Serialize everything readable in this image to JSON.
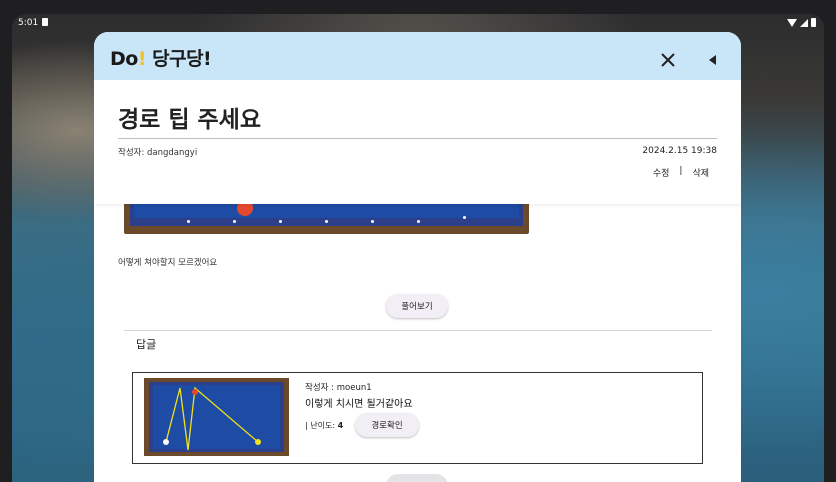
{
  "status_bar": {
    "time": "5:01"
  },
  "app": {
    "logo_prefix": "Do",
    "logo_bang": "!",
    "logo_suffix": " 당구당!"
  },
  "post": {
    "title": "경로 팁 주세요",
    "author": "작성자: dangdangyi",
    "date": "2024.2.15  19:38",
    "edit_label": "수정",
    "separator": "|",
    "delete_label": "삭제",
    "description": "어떻게 쳐야할지 모르겠어요",
    "solve_button": "풀어보기"
  },
  "replies": {
    "label": "답글",
    "items": [
      {
        "author": "작성자 : moeun1",
        "text": "이렇게 치시면 될거같아요",
        "difficulty_label": "| 난이도: ",
        "difficulty_value": "4",
        "route_button": "경로확인"
      }
    ]
  },
  "icons": {
    "close": "close-icon",
    "back": "back-arrow-icon",
    "menu": "menu-icon"
  },
  "colors": {
    "header_bg": "#c9e5f8",
    "logo_accent": "#f4c21b",
    "table_felt": "#1e4ba3",
    "table_frame": "#6b4a2b",
    "red_ball": "#e5482e",
    "yellow_ball": "#f2e21a",
    "route_line": "#f2e21a"
  }
}
